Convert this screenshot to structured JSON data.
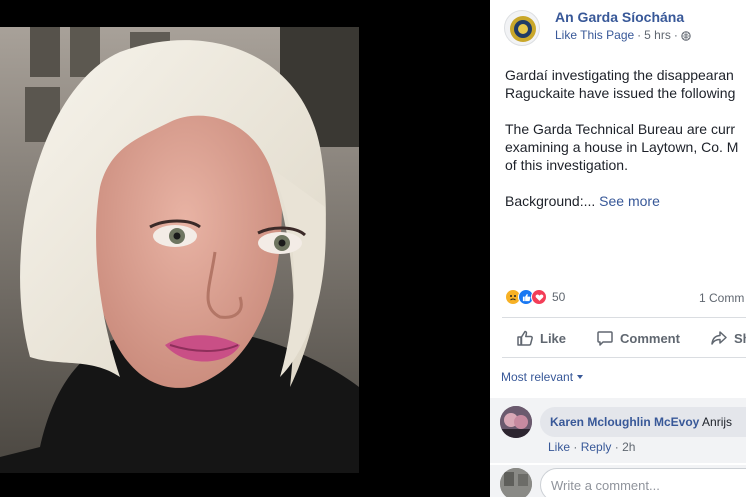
{
  "post": {
    "page_name": "An Garda Síochána",
    "like_page": "Like This Page",
    "separator": "·",
    "time": "5 hrs",
    "paragraphs": [
      "Gardaí investigating the disappearan",
      "Raguckaite have issued the following",
      "The Garda Technical Bureau are curr",
      "examining a house in Laytown, Co. M",
      "of this investigation."
    ],
    "background_label": "Background:...",
    "see_more": "See more"
  },
  "reactions": {
    "count": "50",
    "comments": "1 Comm"
  },
  "actions": {
    "like": "Like",
    "comment": "Comment",
    "share": "Sh"
  },
  "comments_filter": "Most relevant",
  "comment": {
    "author": "Karen Mcloughlin McEvoy",
    "text": "Anrijs",
    "like": "Like",
    "reply": "Reply",
    "time": "2h"
  },
  "write_placeholder": "Write a comment...",
  "icons": [
    "globe-icon",
    "like-icon",
    "comment-icon",
    "share-icon",
    "sad-reaction-icon",
    "like-reaction-icon",
    "love-reaction-icon",
    "caret-down-icon"
  ],
  "colors": {
    "link": "#385898",
    "text": "#1d2129",
    "muted": "#606770",
    "like_blue": "#1877f2",
    "love_red": "#f33e58",
    "sad_yellow": "#f7b125"
  }
}
